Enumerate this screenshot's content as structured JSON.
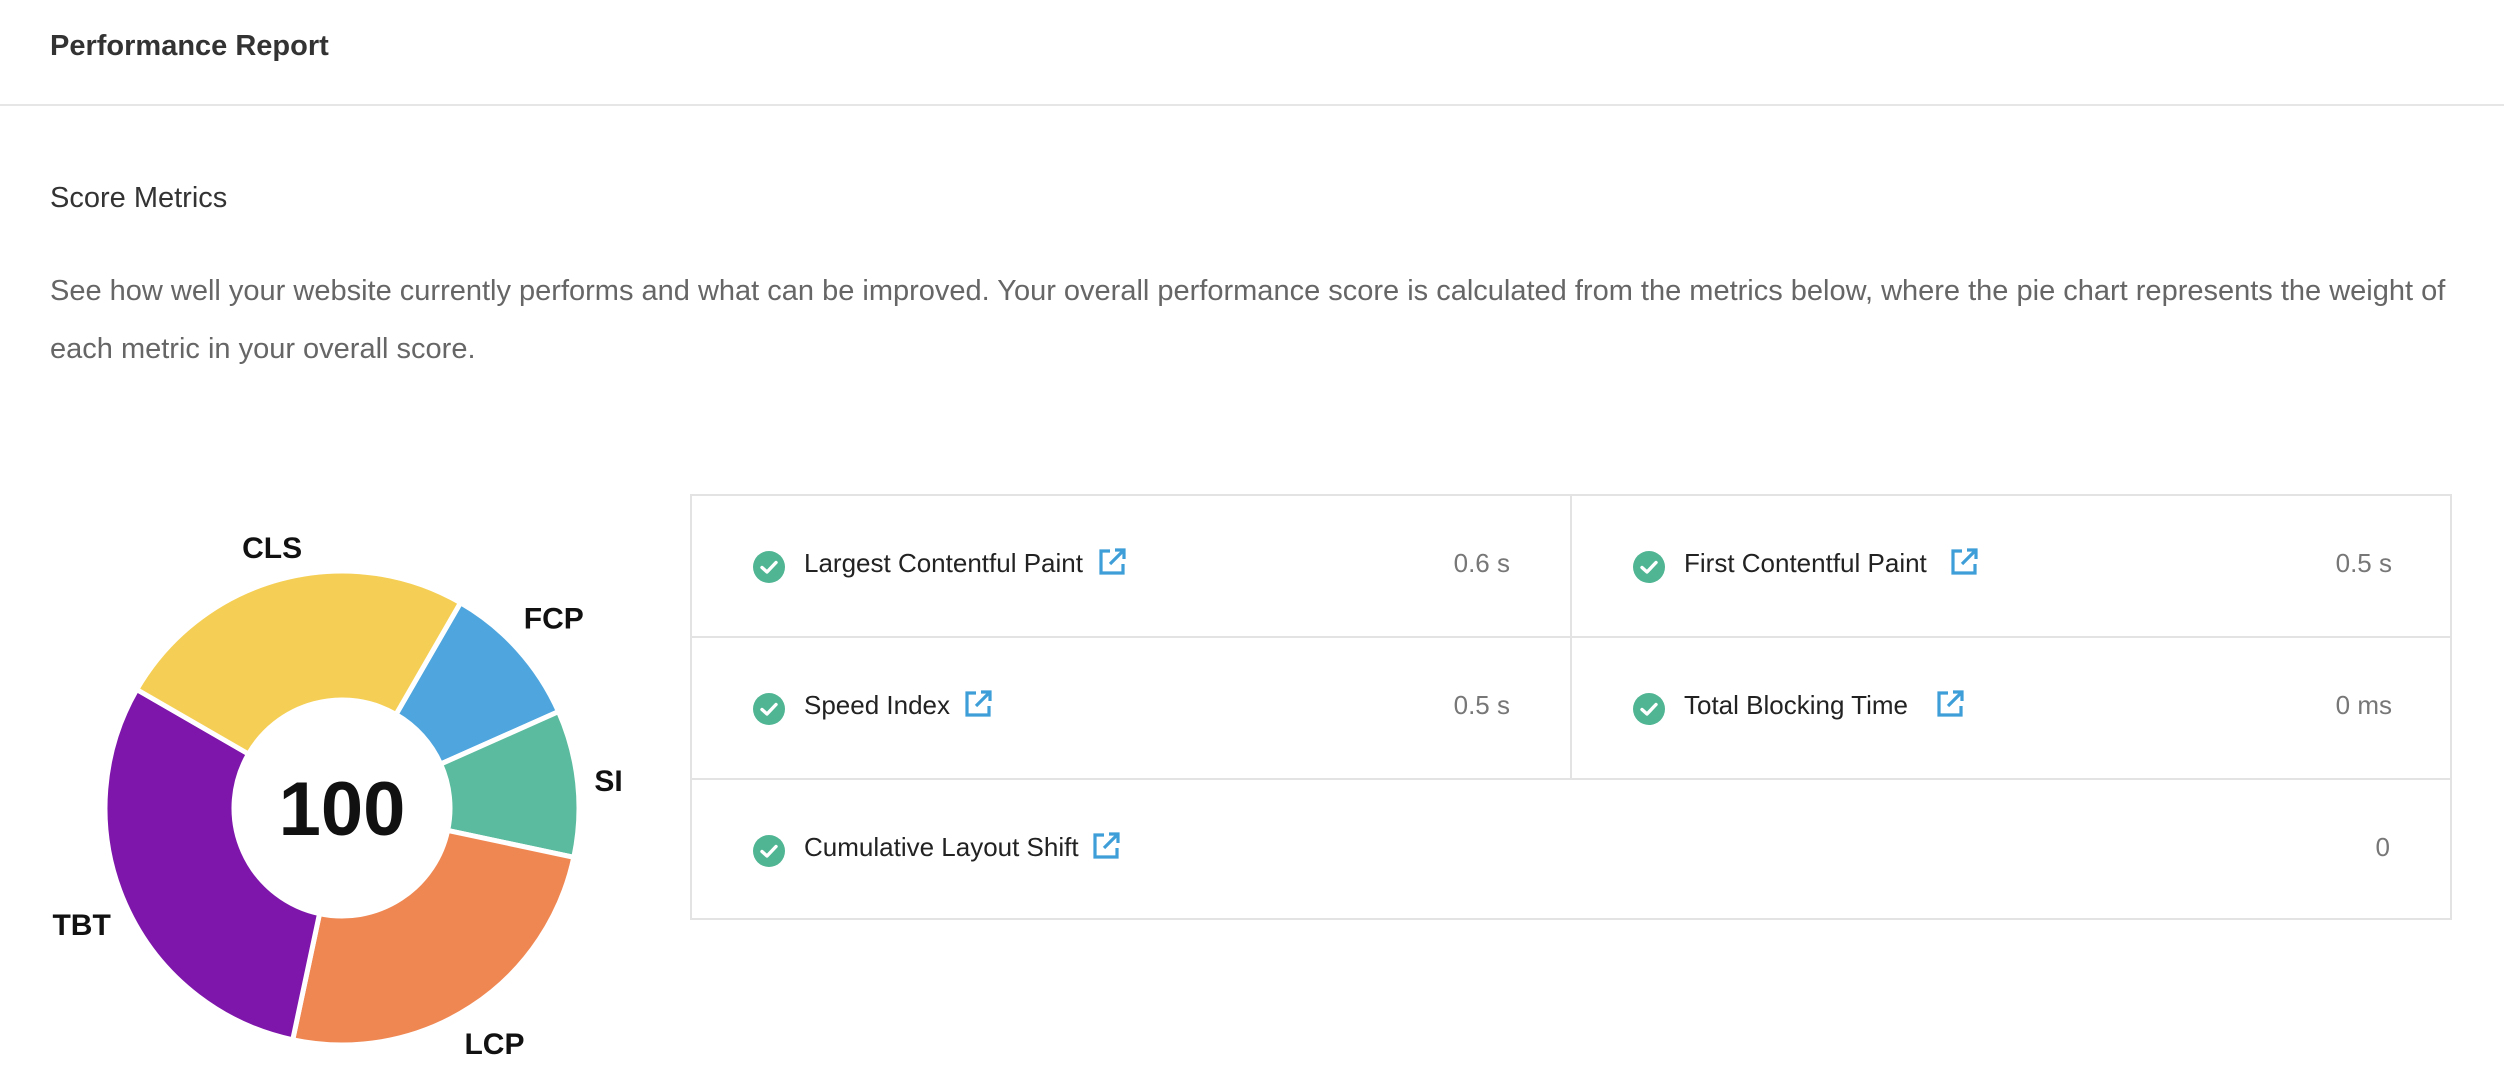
{
  "header": {
    "title": "Performance Report"
  },
  "score_metrics": {
    "title": "Score Metrics",
    "description": "See how well your website currently performs and what can be improved. Your overall performance score is calculated from the metrics below, where the pie chart represents the weight of each metric in your overall score."
  },
  "chart_data": {
    "type": "pie",
    "donut": true,
    "center_label": "100",
    "categories": [
      "FCP",
      "SI",
      "LCP",
      "TBT",
      "CLS"
    ],
    "values": [
      10,
      10,
      25,
      30,
      25
    ],
    "colors": [
      "#4fa6de",
      "#5bbb9e",
      "#ef8753",
      "#7e16ab",
      "#f5cf55"
    ]
  },
  "metrics": [
    {
      "name": "Largest Contentful Paint",
      "value": "0.6 s",
      "status": "pass",
      "icon": "check-circle-icon",
      "link_icon": "external-link-icon"
    },
    {
      "name": "First Contentful Paint",
      "value": "0.5 s",
      "status": "pass",
      "icon": "check-circle-icon",
      "link_icon": "external-link-icon"
    },
    {
      "name": "Speed Index",
      "value": "0.5 s",
      "status": "pass",
      "icon": "check-circle-icon",
      "link_icon": "external-link-icon"
    },
    {
      "name": "Total Blocking Time",
      "value": "0 ms",
      "status": "pass",
      "icon": "check-circle-icon",
      "link_icon": "external-link-icon"
    },
    {
      "name": "Cumulative Layout Shift",
      "value": "0",
      "status": "pass",
      "icon": "check-circle-icon",
      "link_icon": "external-link-icon"
    }
  ],
  "colors": {
    "pass": "#4fb592",
    "link": "#3d9ed8"
  }
}
